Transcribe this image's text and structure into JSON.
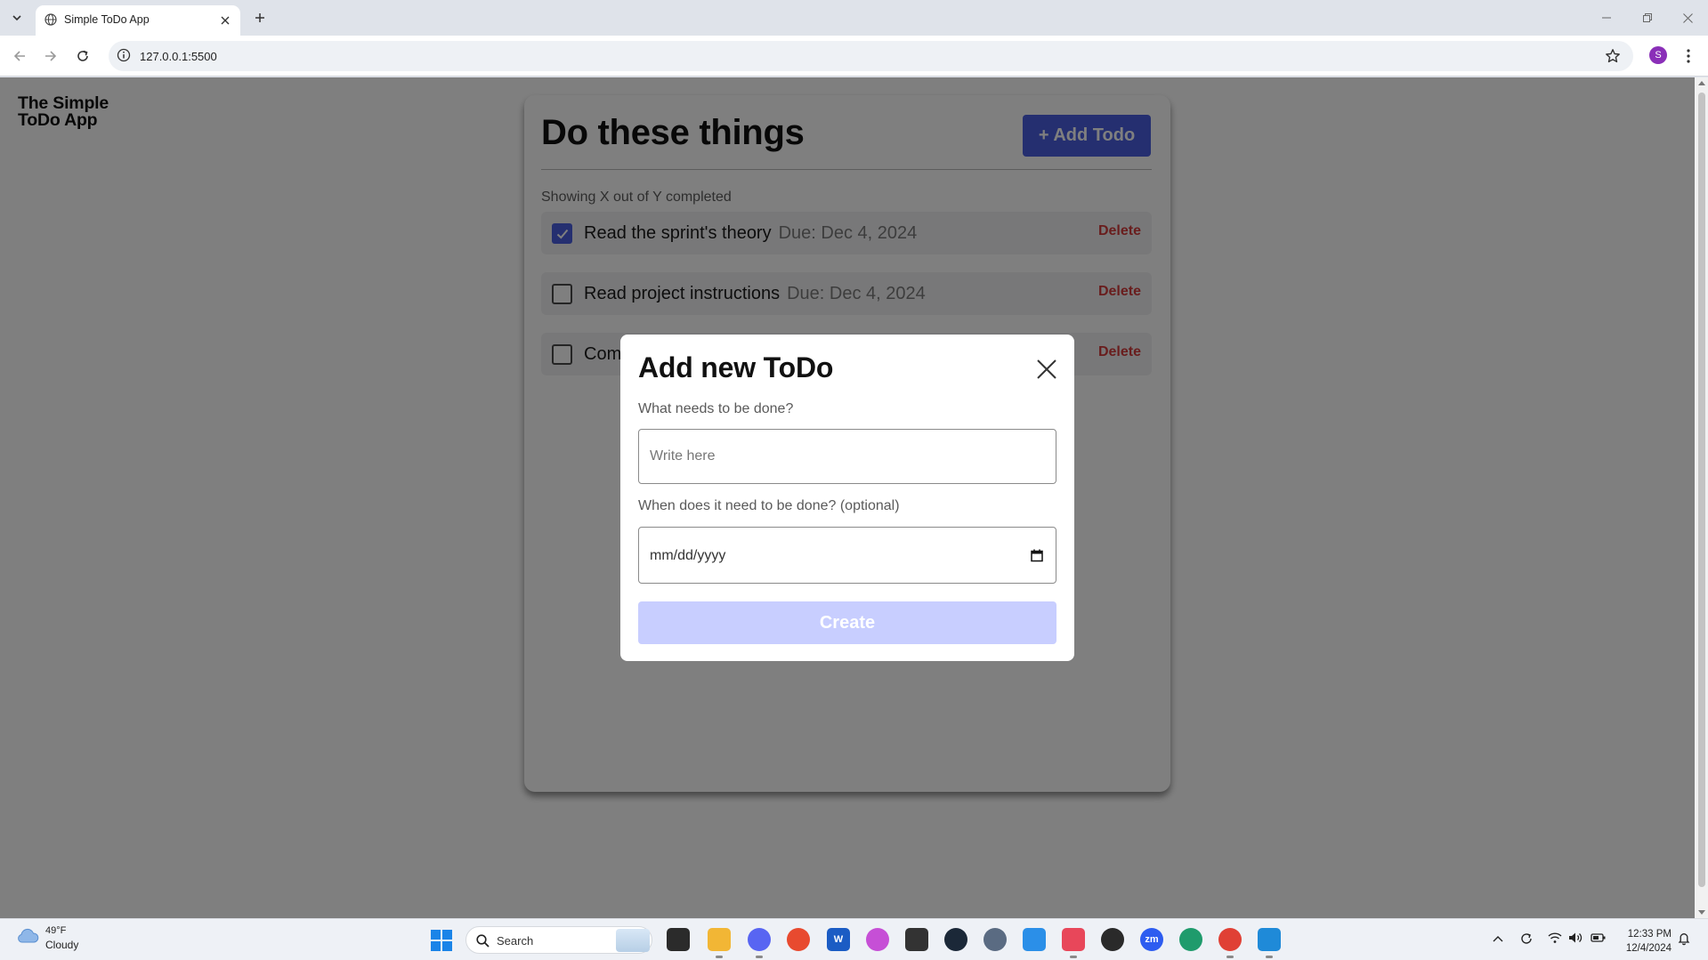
{
  "browser": {
    "tab_title": "Simple ToDo App",
    "url": "127.0.0.1:5500",
    "profile_initial": "S"
  },
  "page": {
    "brand": "The Simple ToDo App",
    "card_title": "Do these things",
    "add_button": "+ Add Todo",
    "summary": "Showing X out of Y completed",
    "todos": [
      {
        "title": "Read the sprint's theory",
        "due": "Due: Dec 4, 2024",
        "checked": true,
        "delete": "Delete"
      },
      {
        "title": "Read project instructions",
        "due": "Due: Dec 4, 2024",
        "checked": false,
        "delete": "Delete"
      },
      {
        "title": "Com",
        "due": "",
        "checked": false,
        "delete": "Delete"
      }
    ]
  },
  "modal": {
    "title": "Add new ToDo",
    "name_label": "What needs to be done?",
    "name_placeholder": "Write here",
    "date_label": "When does it need to be done? (optional)",
    "date_placeholder": "mm/dd/yyyy",
    "create_button": "Create"
  },
  "taskbar": {
    "weather_temp": "49°F",
    "weather_condition": "Cloudy",
    "search_placeholder": "Search",
    "time": "12:33 PM",
    "date": "12/4/2024"
  },
  "colors": {
    "accent": "#4b5fe0",
    "create_disabled": "#c8ceff",
    "delete": "#d33b3b"
  }
}
